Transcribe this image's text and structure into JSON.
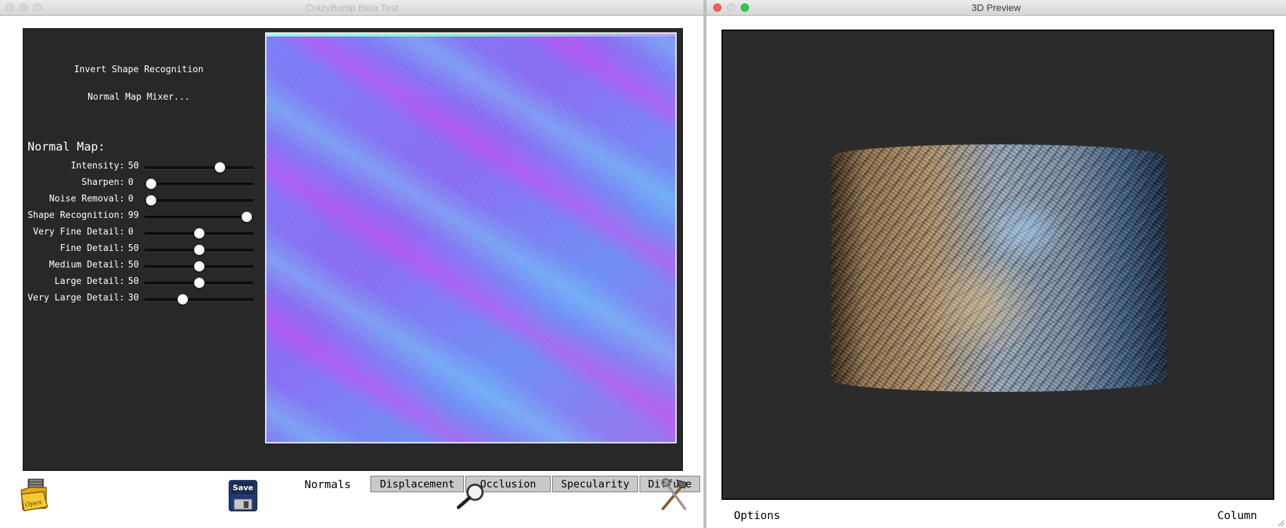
{
  "main_window": {
    "title": "CrazyBump Beta Test",
    "menu": {
      "invert_shape": "Invert Shape Recognition",
      "mixer": "Normal Map Mixer..."
    },
    "section_title": "Normal Map:",
    "sliders": [
      {
        "label": "Intensity:",
        "value": "50",
        "level": 0.72
      },
      {
        "label": "Sharpen:",
        "value": "0",
        "level": 0.0
      },
      {
        "label": "Noise Removal:",
        "value": "0",
        "level": 0.0
      },
      {
        "label": "Shape Recognition:",
        "value": "99",
        "level": 1.0
      },
      {
        "label": "Very Fine Detail:",
        "value": "0",
        "level": 0.5
      },
      {
        "label": "Fine Detail:",
        "value": "50",
        "level": 0.5
      },
      {
        "label": "Medium Detail:",
        "value": "50",
        "level": 0.5
      },
      {
        "label": "Large Detail:",
        "value": "50",
        "level": 0.5
      },
      {
        "label": "Very Large Detail:",
        "value": "30",
        "level": 0.33
      }
    ],
    "tabs": [
      {
        "label": "Normals",
        "active": true
      },
      {
        "label": "Displacement",
        "active": false
      },
      {
        "label": "Occlusion",
        "active": false
      },
      {
        "label": "Specularity",
        "active": false
      },
      {
        "label": "Diffuse",
        "active": false
      }
    ],
    "toolbar": {
      "open_label": "Open",
      "save_label": "Save"
    }
  },
  "preview_window": {
    "title": "3D Preview",
    "options_label": "Options",
    "shape_label": "Column"
  },
  "colors": {
    "panel_bg": "#282828",
    "viewport_bg": "#2b2b2b",
    "close": "#fc605c",
    "zoom": "#34c84a"
  }
}
